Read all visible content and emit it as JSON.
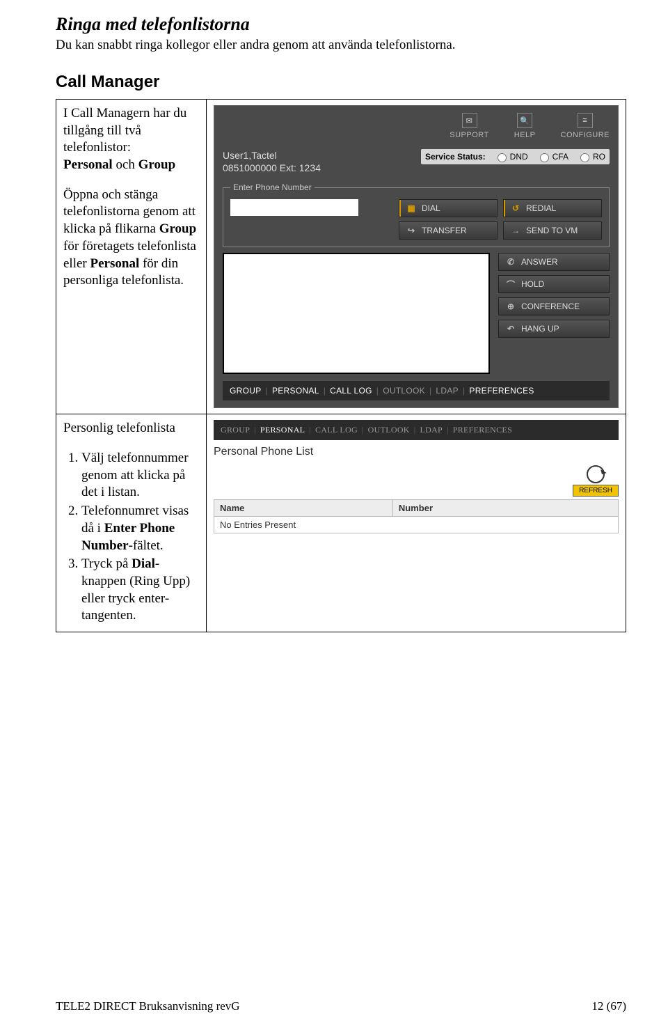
{
  "doc": {
    "heading": "Ringa med telefonlistorna",
    "intro": "Du kan snabbt ringa kollegor eller andra genom att använda telefonlistorna.",
    "section": "Call Manager",
    "left1a": "I Call Managern har du tillgång till två telefonlistor:",
    "left1b_pre": "",
    "left1b_b1": "Personal",
    "left1b_mid": " och ",
    "left1b_b2": "Group",
    "left2a": "Öppna och stänga telefonlistorna genom att klicka på flikarna ",
    "left2b": "Group",
    "left2c": " för företagets telefonlista eller ",
    "left2d": "Personal",
    "left2e": " för din personliga telefonlista.",
    "left3": "Personlig telefonlista",
    "step1": "Välj telefonnummer genom att klicka på det i listan.",
    "step2_a": "Telefonnumret visas då i ",
    "step2_b": "Enter Phone Number",
    "step2_c": "-fältet.",
    "step3_a": "Tryck på ",
    "step3_b": "Dial",
    "step3_c": "-knappen (Ring Upp) eller tryck enter-tangenten.",
    "footer_left": "TELE2 DIRECT Bruksanvisning revG",
    "footer_right": "12 (67)"
  },
  "cm": {
    "top": {
      "support": "SUPPORT",
      "help": "HELP",
      "configure": "CONFIGURE"
    },
    "user_line1": "User1,Tactel",
    "user_line2": "0851000000 Ext: 1234",
    "ss_label": "Service Status:",
    "ss_dnd": "DND",
    "ss_cfa": "CFA",
    "ss_ro": "RO",
    "legend": "Enter Phone Number",
    "btn": {
      "dial": "DIAL",
      "redial": "REDIAL",
      "transfer": "TRANSFER",
      "sendvm": "SEND TO VM",
      "answer": "ANSWER",
      "hold": "HOLD",
      "conference": "CONFERENCE",
      "hangup": "HANG UP"
    },
    "tabs": [
      "GROUP",
      "PERSONAL",
      "CALL LOG",
      "OUTLOOK",
      "LDAP",
      "PREFERENCES"
    ]
  },
  "pp": {
    "tabs": [
      "GROUP",
      "PERSONAL",
      "CALL LOG",
      "OUTLOOK",
      "LDAP",
      "PREFERENCES"
    ],
    "title": "Personal Phone List",
    "refresh": "REFRESH",
    "col_name": "Name",
    "col_number": "Number",
    "empty": "No Entries Present"
  }
}
